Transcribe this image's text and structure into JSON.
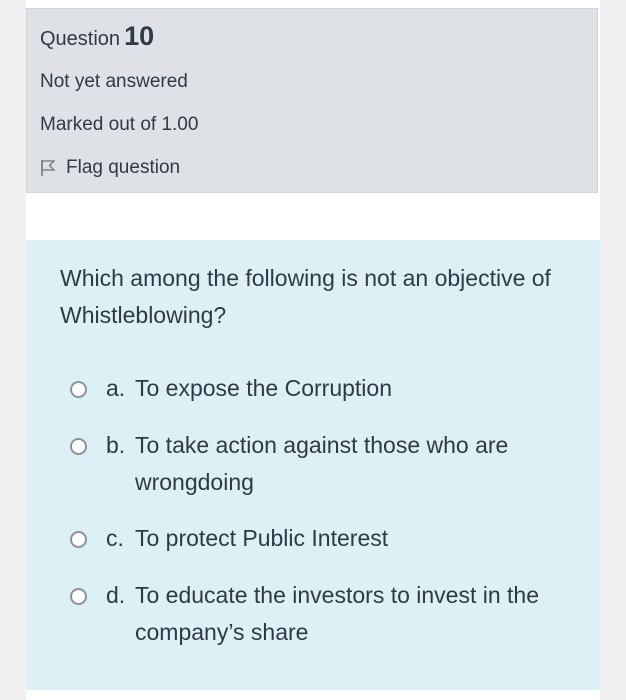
{
  "info": {
    "question_word": "Question",
    "question_number": "10",
    "status": "Not yet answered",
    "marked": "Marked out of 1.00",
    "flag_label": "Flag question"
  },
  "question": {
    "text": "Which among the following is not an objective of Whistleblowing?",
    "options": [
      {
        "letter": "a.",
        "text": "To expose the Corruption",
        "selected": false
      },
      {
        "letter": "b.",
        "text": "To take action against those who are wrongdoing",
        "selected": false
      },
      {
        "letter": "c.",
        "text": "To protect Public Interest",
        "selected": false
      },
      {
        "letter": "d.",
        "text": "To educate the investors to invest in the company’s share",
        "selected": false
      }
    ]
  },
  "colors": {
    "info_panel": "#dee2e6",
    "question_panel": "#dcf0f6",
    "text": "#2f3a45"
  },
  "icons": {
    "flag": "flag-outline-icon",
    "radio": "radio-unselected-icon"
  }
}
